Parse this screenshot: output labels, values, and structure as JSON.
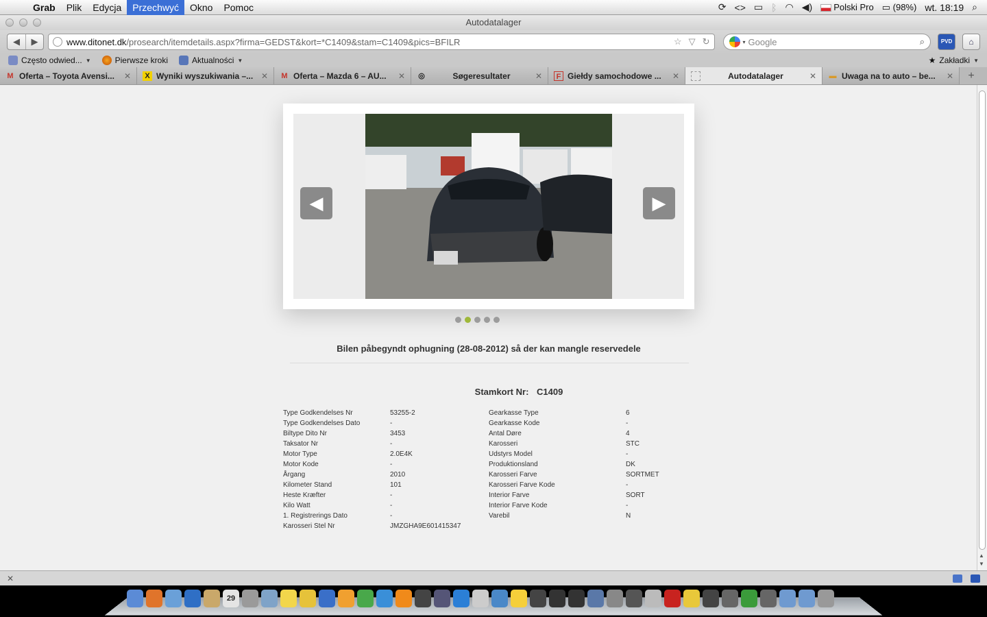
{
  "menubar": {
    "app": "Grab",
    "items": [
      "Plik",
      "Edycja",
      "Przechwyć",
      "Okno",
      "Pomoc"
    ],
    "active_item": "Przechwyć",
    "input_source": "Polski Pro",
    "battery": "(98%)",
    "clock": "wt. 18:19"
  },
  "window": {
    "title": "Autodatalager"
  },
  "navbar": {
    "url_host": "www.ditonet.dk",
    "url_path": "/prosearch/itemdetails.aspx?firma=GEDST&kort=*C1409&stam=C1409&pics=BFILR",
    "search_placeholder": "Google"
  },
  "bookmarks": {
    "items": [
      {
        "label": "Często odwied...",
        "icon": "frequent-sites-icon",
        "dropdown": true
      },
      {
        "label": "Pierwsze kroki",
        "icon": "firefox-icon",
        "dropdown": false
      },
      {
        "label": "Aktualności",
        "icon": "rss-icon",
        "dropdown": true
      }
    ],
    "right_label": "Zakładki"
  },
  "tabs": [
    {
      "label": "Oferta – Toyota Avensi...",
      "icon": "gmail-icon",
      "fav": "M",
      "color": "#c5352b",
      "active": false
    },
    {
      "label": "Wyniki wyszukiwania –...",
      "icon": "raiffeisen-icon",
      "fav": "X",
      "color": "#222222",
      "active": false
    },
    {
      "label": "Oferta – Mazda 6 – AU...",
      "icon": "gmail-icon",
      "fav": "M",
      "color": "#c5352b",
      "active": false
    },
    {
      "label": "Søgeresultater",
      "icon": "target-icon",
      "fav": "◎",
      "color": "#333333",
      "active": false
    },
    {
      "label": "Giełdy samochodowe ...",
      "icon": "fs-icon",
      "fav": "F",
      "color": "#c5352b",
      "active": false
    },
    {
      "label": "Autodatalager",
      "icon": "blank-page-icon",
      "fav": "",
      "color": "#999999",
      "active": true
    },
    {
      "label": "Uwaga na to auto – be...",
      "icon": "car-icon",
      "fav": "🚗",
      "color": "#d89a2b",
      "active": false
    }
  ],
  "gallery": {
    "dots_total": 5,
    "active_dot": 1
  },
  "notice": "Bilen påbegyndt ophugning (28-08-2012) så der kan mangle reservedele",
  "stamkort": {
    "label": "Stamkort Nr:",
    "value": "C1409"
  },
  "specs_left": [
    {
      "label": "Type Godkendelses Nr",
      "value": "53255-2"
    },
    {
      "label": "Type Godkendelses Dato",
      "value": "-"
    },
    {
      "label": "Biltype Dito Nr",
      "value": "3453"
    },
    {
      "label": "Taksator Nr",
      "value": "-"
    },
    {
      "label": "Motor Type",
      "value": "2.0E4K"
    },
    {
      "label": "Motor Kode",
      "value": "-"
    },
    {
      "label": "Årgang",
      "value": "2010"
    },
    {
      "label": "Kilometer Stand",
      "value": "101"
    },
    {
      "label": "Heste Kræfter",
      "value": "-"
    },
    {
      "label": "Kilo Watt",
      "value": "-"
    },
    {
      "label": "1. Registrerings Dato",
      "value": "-"
    },
    {
      "label": "Karosseri Stel Nr",
      "value": "JMZGHA9E601415347"
    }
  ],
  "specs_right": [
    {
      "label": "Gearkasse Type",
      "value": "6"
    },
    {
      "label": "Gearkasse Kode",
      "value": "-"
    },
    {
      "label": "Antal Døre",
      "value": "4"
    },
    {
      "label": "Karosseri",
      "value": "STC"
    },
    {
      "label": "Udstyrs Model",
      "value": "-"
    },
    {
      "label": "Produktionsland",
      "value": "DK"
    },
    {
      "label": "Karosseri Farve",
      "value": "SORTMET"
    },
    {
      "label": "Karosseri Farve Kode",
      "value": "-"
    },
    {
      "label": "Interior Farve",
      "value": "SORT"
    },
    {
      "label": "Interior Farve Kode",
      "value": "-"
    },
    {
      "label": "Varebil",
      "value": "N"
    }
  ],
  "dock": {
    "icons": [
      "finder-icon",
      "firefox-icon",
      "preview-icon",
      "safari-icon",
      "address-book-icon",
      "ical-icon",
      "calculator-icon",
      "preview2-icon",
      "stickies-icon",
      "font-icon",
      "word-icon",
      "pages-icon",
      "numbers-icon",
      "itunes-icon",
      "vlc-icon",
      "pvp-icon",
      "mplayer-icon",
      "quicktime-icon",
      "iphone-icon",
      "network-icon",
      "fl-icon",
      "soccer-icon",
      "clapper-icon",
      "clapper2-icon",
      "textedit-icon",
      "grab-icon",
      "ssh-icon",
      "keychain-icon",
      "filezilla-icon",
      "banana-icon",
      "x11-icon",
      "hat-icon",
      "sky-icon",
      "utilities-icon",
      "folder-icon",
      "folder2-icon",
      "trash-icon"
    ],
    "ical_day": "29"
  }
}
